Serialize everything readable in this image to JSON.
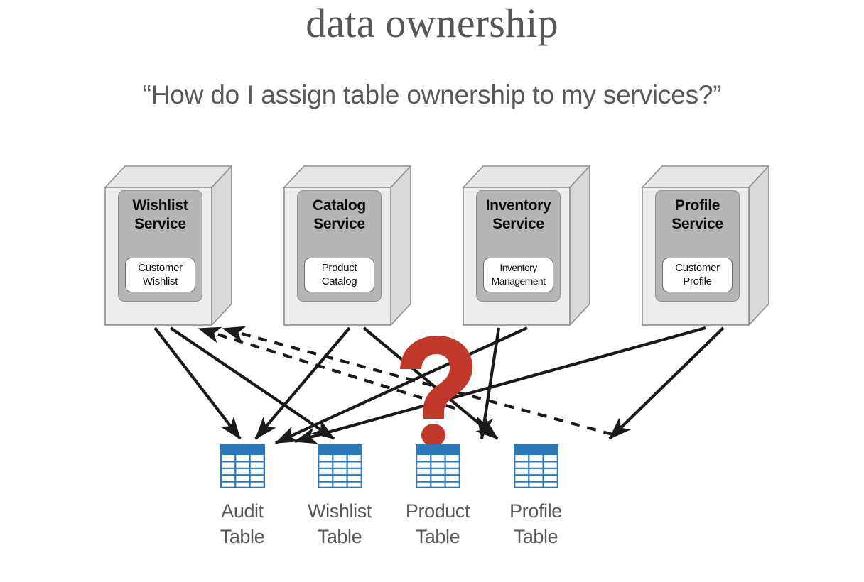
{
  "slide": {
    "title": "data ownership",
    "subtitle": "“How do I assign table ownership to my services?”"
  },
  "colors": {
    "title_text": "#565656",
    "subtitle_text": "#585858",
    "service_box_face": "#ececec",
    "service_box_top": "#e2e2e2",
    "service_box_side": "#d8d8d8",
    "service_inner_panel": "#b6b6b6",
    "service_chip": "#ffffff",
    "table_header_blue": "#2b77b8",
    "table_grid_blue": "#2b77b8",
    "question_mark_red": "#c0392b",
    "arrow_black": "#1a1a1a",
    "background": "#ffffff"
  },
  "services": [
    {
      "id": "wishlist-service",
      "title_line1": "Wishlist",
      "title_line2": "Service",
      "chip_line1": "Customer",
      "chip_line2": "Wishlist"
    },
    {
      "id": "catalog-service",
      "title_line1": "Catalog",
      "title_line2": "Service",
      "chip_line1": "Product",
      "chip_line2": "Catalog"
    },
    {
      "id": "inventory-service",
      "title_line1": "Inventory",
      "title_line2": "Service",
      "chip_line1": "Inventory",
      "chip_line2": "Management"
    },
    {
      "id": "profile-service",
      "title_line1": "Profile",
      "title_line2": "Service",
      "chip_line1": "Customer",
      "chip_line2": "Profile"
    }
  ],
  "tables": [
    {
      "id": "audit-table",
      "label_line1": "Audit",
      "label_line2": "Table"
    },
    {
      "id": "wishlist-table",
      "label_line1": "Wishlist",
      "label_line2": "Table"
    },
    {
      "id": "product-table",
      "label_line1": "Product",
      "label_line2": "Table"
    },
    {
      "id": "profile-table",
      "label_line1": "Profile",
      "label_line2": "Table"
    }
  ],
  "question_mark": {
    "glyph": "?",
    "meaning": "unclear-data-ownership"
  },
  "connections": {
    "solid_description": "service writes to table",
    "dashed_description": "table read back by service",
    "solid": [
      {
        "from": "wishlist-service",
        "to": "audit-table"
      },
      {
        "from": "wishlist-service",
        "to": "wishlist-table"
      },
      {
        "from": "catalog-service",
        "to": "audit-table"
      },
      {
        "from": "catalog-service",
        "to": "product-table"
      },
      {
        "from": "inventory-service",
        "to": "audit-table"
      },
      {
        "from": "inventory-service",
        "to": "product-table"
      },
      {
        "from": "profile-service",
        "to": "audit-table"
      },
      {
        "from": "profile-service",
        "to": "profile-table"
      }
    ],
    "dashed": [
      {
        "from": "product-table",
        "to": "wishlist-service"
      },
      {
        "from": "profile-table",
        "to": "wishlist-service"
      }
    ]
  }
}
